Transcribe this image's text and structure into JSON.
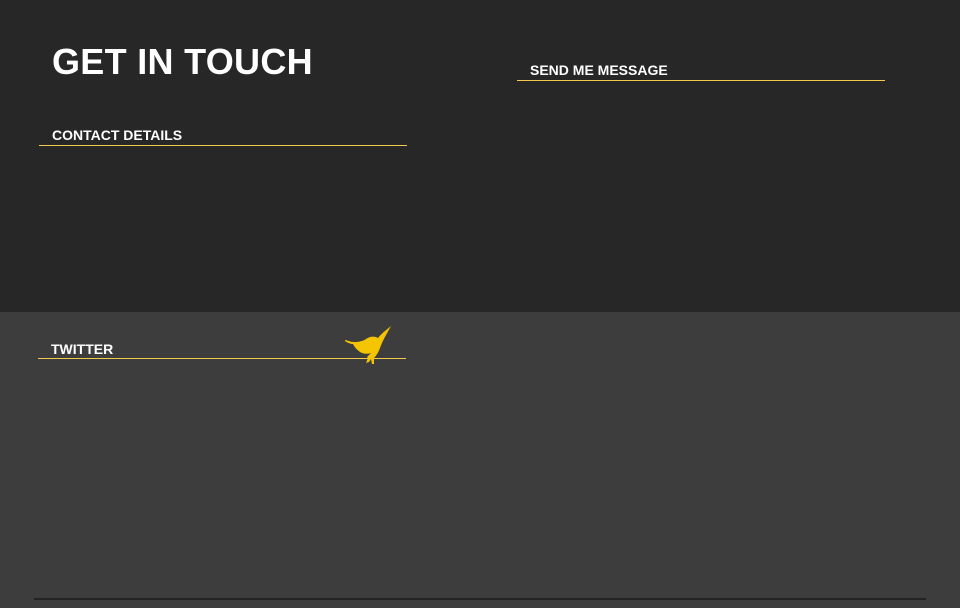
{
  "page": {
    "title": "GET IN TOUCH"
  },
  "sections": {
    "contact": {
      "heading": "CONTACT DETAILS"
    },
    "message": {
      "heading": "SEND ME MESSAGE"
    },
    "twitter": {
      "heading": "TWITTER",
      "icon": "twitter-bird-icon"
    }
  },
  "colors": {
    "top_background": "#272727",
    "bottom_background": "#3d3d3d",
    "accent": "#f2c94c",
    "icon": "#f5c400",
    "text": "#ffffff"
  }
}
